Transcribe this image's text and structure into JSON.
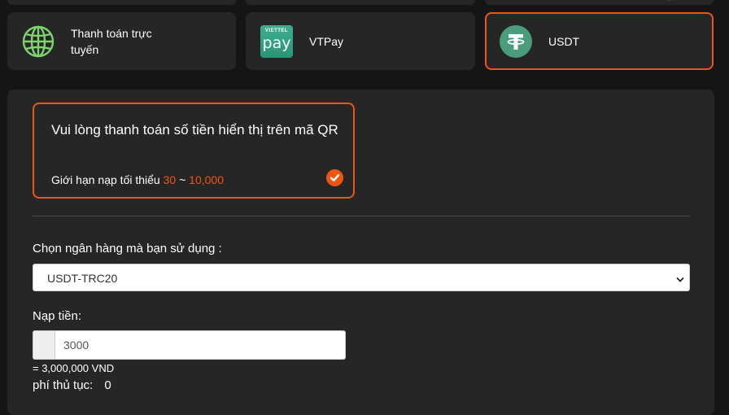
{
  "payment_methods": [
    {
      "label": "Thanh toán trực tuyến",
      "icon": "globe-icon",
      "selected": false
    },
    {
      "label": "VTPay",
      "icon": "vtpay-icon",
      "icon_text_top": "VIETTEL",
      "icon_text_main": "pay",
      "selected": false
    },
    {
      "label": "USDT",
      "icon": "tether-icon",
      "selected": true
    }
  ],
  "notice": {
    "title": "Vui lòng thanh toán số tiền hiển thị trên mã QR",
    "limit_prefix": "Giới hạn nạp tối thiểu",
    "limit_min": "30",
    "limit_separator": "~",
    "limit_max": "10,000"
  },
  "bank": {
    "label": "Chọn ngân hàng mà bạn sử dụng :",
    "selected_option": "USDT-TRC20"
  },
  "deposit": {
    "label": "Nạp tiền:",
    "amount_value": "3000",
    "converted": "= 3,000,000 VND"
  },
  "fee": {
    "label": "phí thủ tục:",
    "value": "0"
  },
  "colors": {
    "accent": "#ee5511",
    "background": "#151515",
    "panel": "#262626",
    "globe": "#7fd36e",
    "tether": "#4a9d7c",
    "vtpay": "#3fae8e"
  }
}
